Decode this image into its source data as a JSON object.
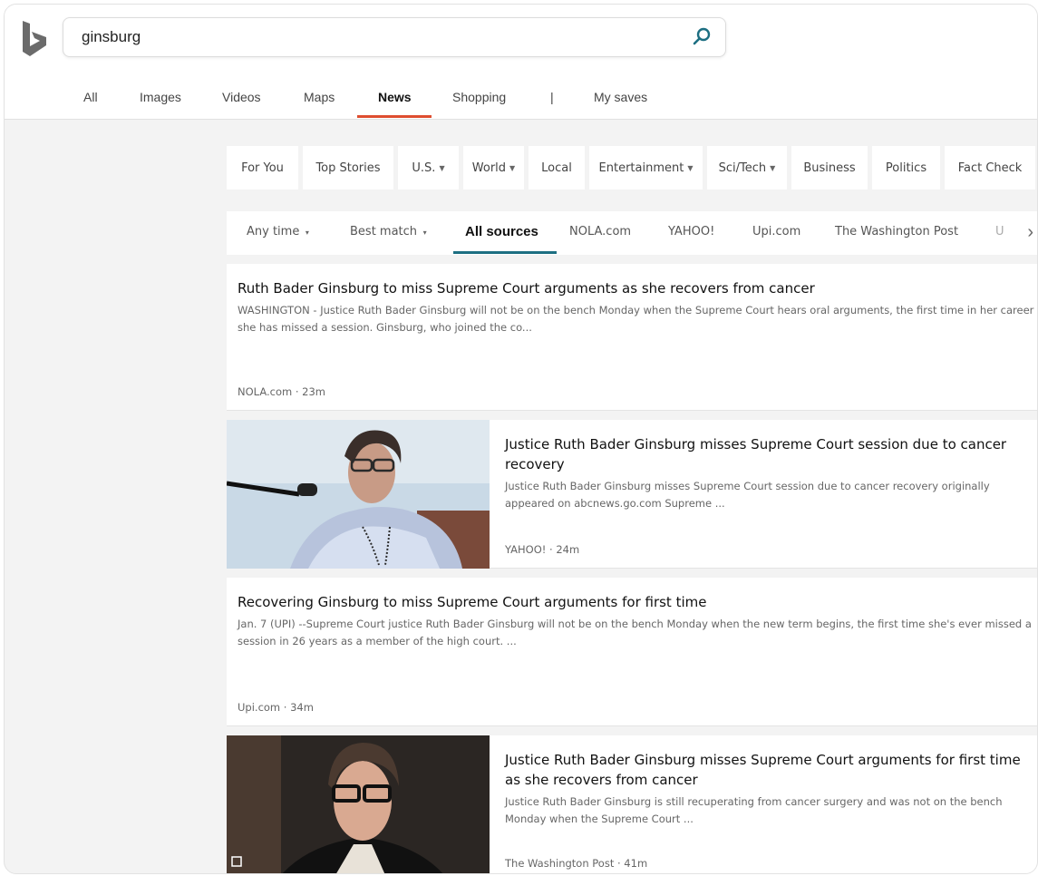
{
  "search": {
    "query": "ginsburg"
  },
  "scopes": [
    {
      "label": "All"
    },
    {
      "label": "Images"
    },
    {
      "label": "Videos"
    },
    {
      "label": "Maps"
    },
    {
      "label": "News"
    },
    {
      "label": "Shopping"
    },
    {
      "label": "|"
    },
    {
      "label": "My saves"
    }
  ],
  "categories": [
    {
      "label": "For You"
    },
    {
      "label": "Top Stories"
    },
    {
      "label": "U.S."
    },
    {
      "label": "World"
    },
    {
      "label": "Local"
    },
    {
      "label": "Entertainment"
    },
    {
      "label": "Sci/Tech"
    },
    {
      "label": "Business"
    },
    {
      "label": "Politics"
    },
    {
      "label": "Fact Check"
    }
  ],
  "filters": [
    {
      "label": "Any time"
    },
    {
      "label": "Best match"
    },
    {
      "label": "All sources"
    },
    {
      "label": "NOLA.com"
    },
    {
      "label": "YAHOO!"
    },
    {
      "label": "Upi.com"
    },
    {
      "label": "The Washington Post"
    },
    {
      "label": "U"
    }
  ],
  "articles": [
    {
      "title": "Ruth Bader Ginsburg to miss Supreme Court arguments as she recovers from cancer",
      "snippet": "WASHINGTON - Justice Ruth Bader Ginsburg will not be on the bench Monday when the Supreme Court hears oral arguments, the first time in her career she has missed a session. Ginsburg, who joined the co...",
      "source": "NOLA.com · 23m"
    },
    {
      "title": "Justice Ruth Bader Ginsburg misses Supreme Court session due to cancer recovery",
      "snippet": "Justice Ruth Bader Ginsburg misses Supreme Court session due to cancer recovery originally appeared on abcnews.go.com Supreme ...",
      "source": "YAHOO! · 24m"
    },
    {
      "title": "Recovering Ginsburg to miss Supreme Court arguments for first time",
      "snippet": "Jan. 7 (UPI) --Supreme Court justice Ruth Bader Ginsburg will not be on the bench Monday when the new term begins, the first time she's ever missed a session in 26 years as a member of the high court. ...",
      "source": "Upi.com · 34m"
    },
    {
      "title": "Justice Ruth Bader Ginsburg misses Supreme Court arguments for first time as she recovers from cancer",
      "snippet": "Justice Ruth Bader Ginsburg is still recuperating from cancer surgery and was not on the bench Monday when the Supreme Court ...",
      "source": "The Washington Post · 41m"
    }
  ],
  "colors": {
    "logo": "#6b6b6b",
    "news_accent": "#de4e2f",
    "filter_accent": "#1d6f82",
    "search_icon": "#1d6f82"
  }
}
